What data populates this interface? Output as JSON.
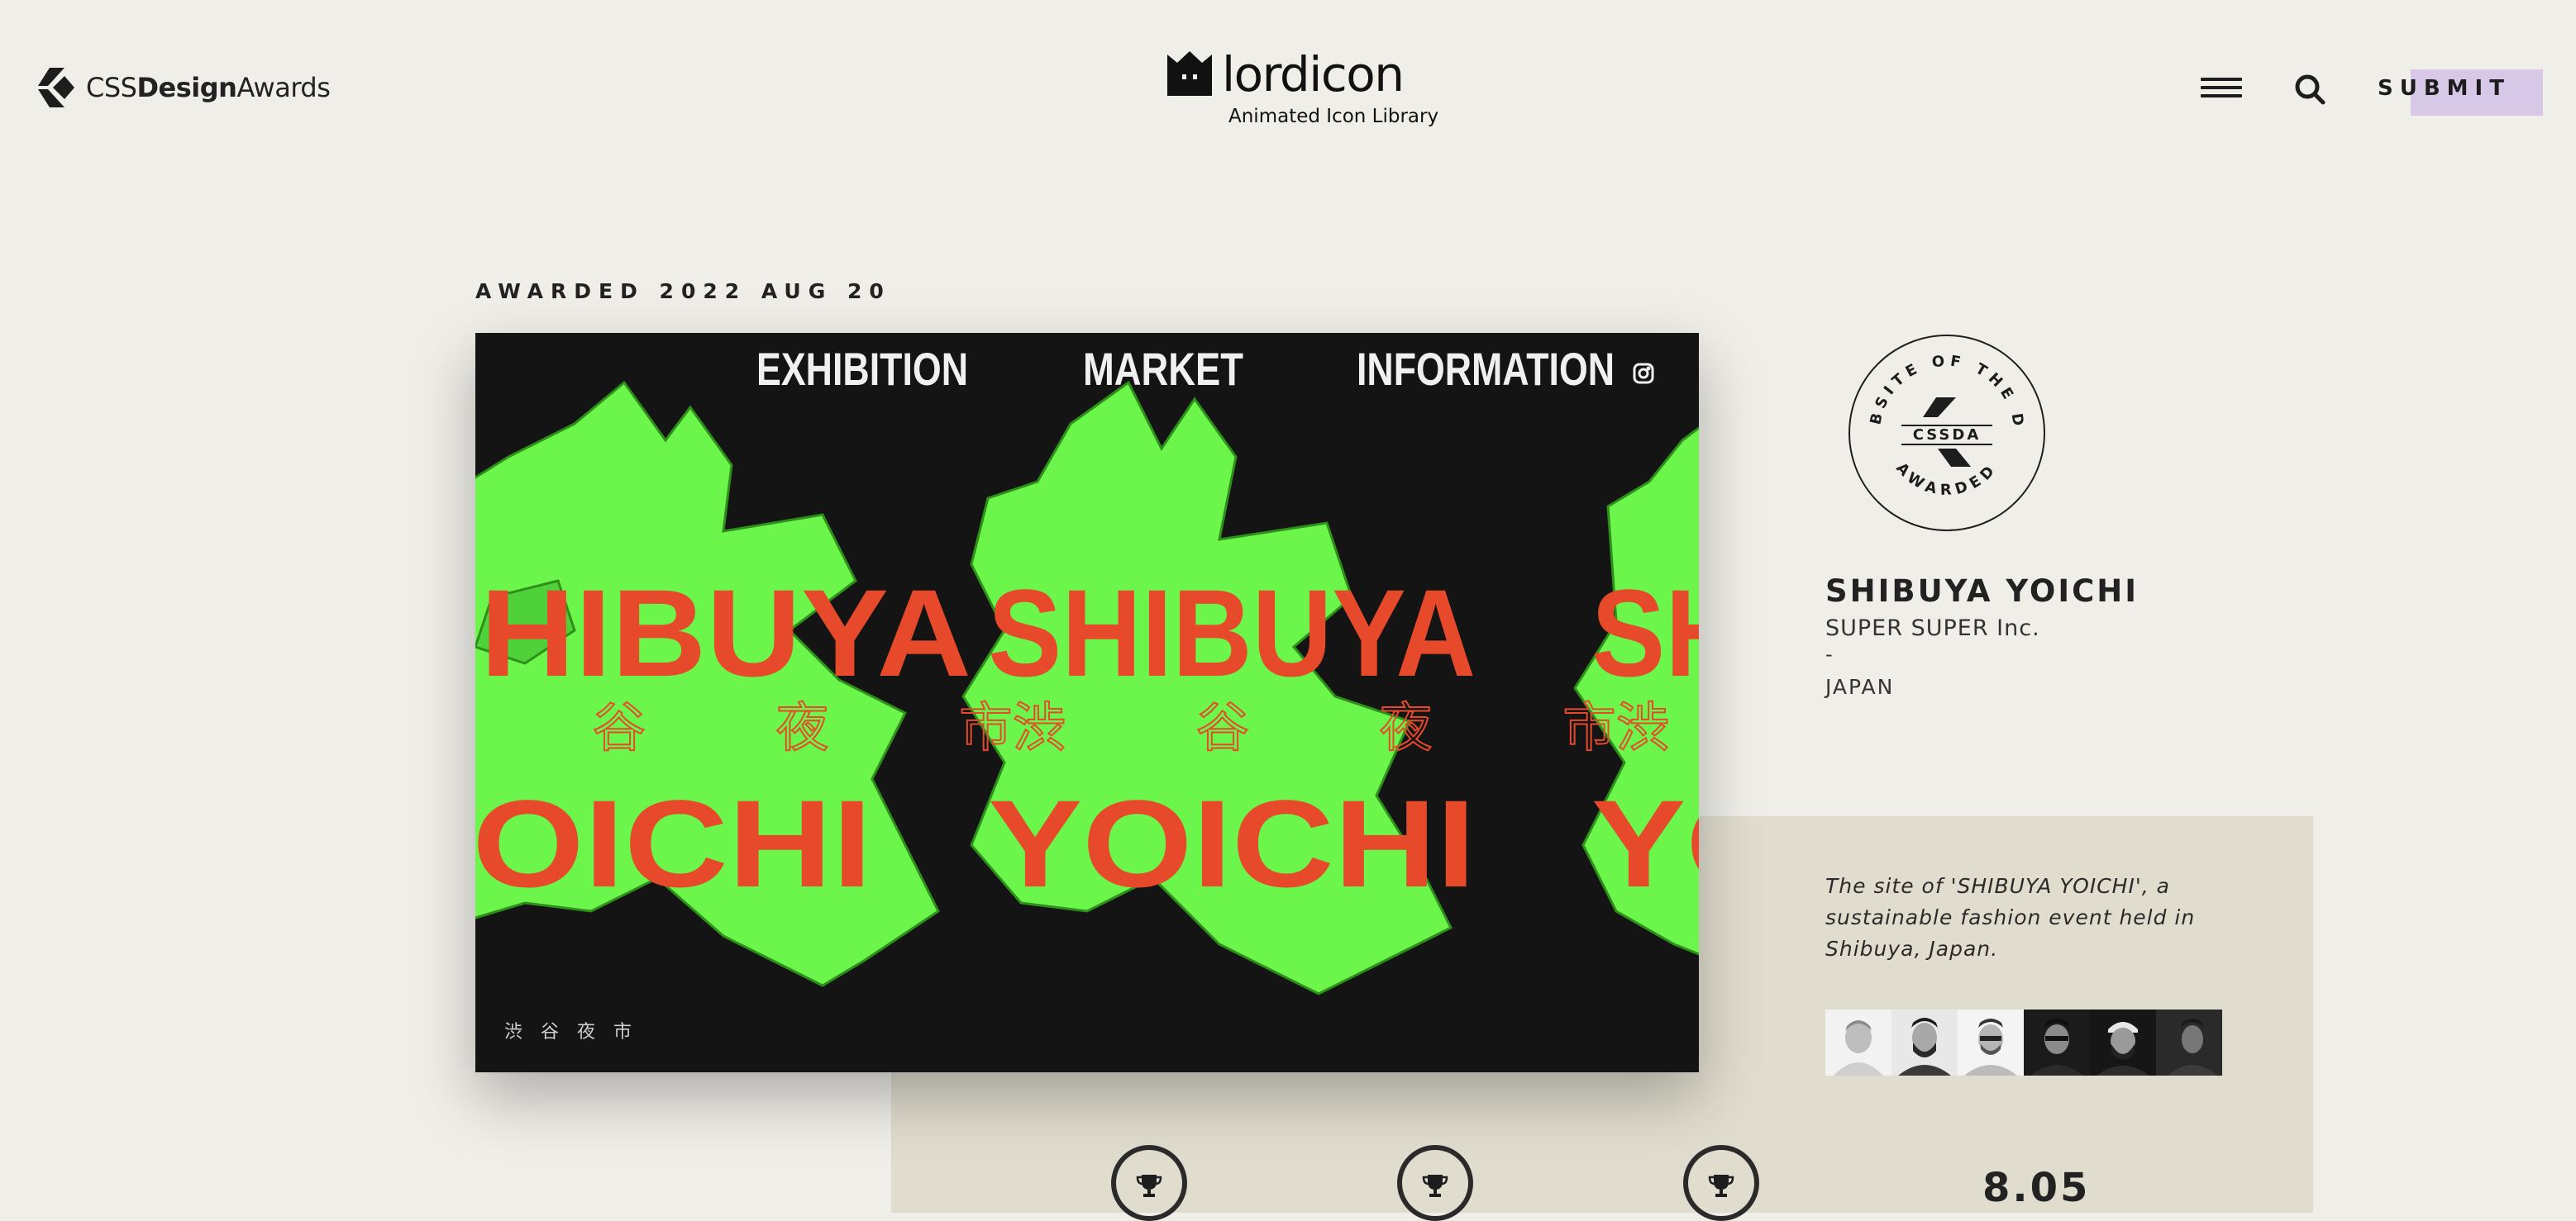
{
  "header": {
    "logo": {
      "prefix": "CSS",
      "bold": "Design",
      "suffix": "Awards"
    },
    "sponsor": {
      "name": "lordicon",
      "tagline": "Animated Icon Library"
    },
    "submit_label": "SUBMIT",
    "colors": {
      "submit_bg": "#d8c8e8"
    }
  },
  "award": {
    "date_label": "AWARDED 2022 AUG 20"
  },
  "screenshot": {
    "nav": [
      "EXHIBITION",
      "MARKET",
      "INFORMATION"
    ],
    "headline_top": "SHIBUYA",
    "headline_bottom": "YOICHI",
    "kanji_row": "渋 谷 夜 市",
    "footer_kanji": "渋　谷　夜　市",
    "colors": {
      "bg": "#141414",
      "green": "#6cf54a",
      "red": "#e64a2a",
      "nav": "#f0f0f0"
    }
  },
  "badge": {
    "top_text": "WEBSITE OF THE DAY",
    "bottom_text": "AWARDED",
    "center": "CSSDA"
  },
  "site": {
    "title": "SHIBUYA YOICHI",
    "author": "SUPER SUPER Inc.",
    "separator": "-",
    "country": "JAPAN",
    "description": "The site of 'SHIBUYA YOICHI', a sustainable fashion event held in Shibuya, Japan."
  },
  "jury": [
    {
      "name": "juror-1"
    },
    {
      "name": "juror-2"
    },
    {
      "name": "juror-3"
    },
    {
      "name": "juror-4"
    },
    {
      "name": "juror-5"
    },
    {
      "name": "juror-6"
    }
  ],
  "score": "8.05",
  "colors": {
    "page_bg": "#efeee9",
    "panel_bg": "#e0ddcf",
    "text": "#1d1d1d"
  }
}
